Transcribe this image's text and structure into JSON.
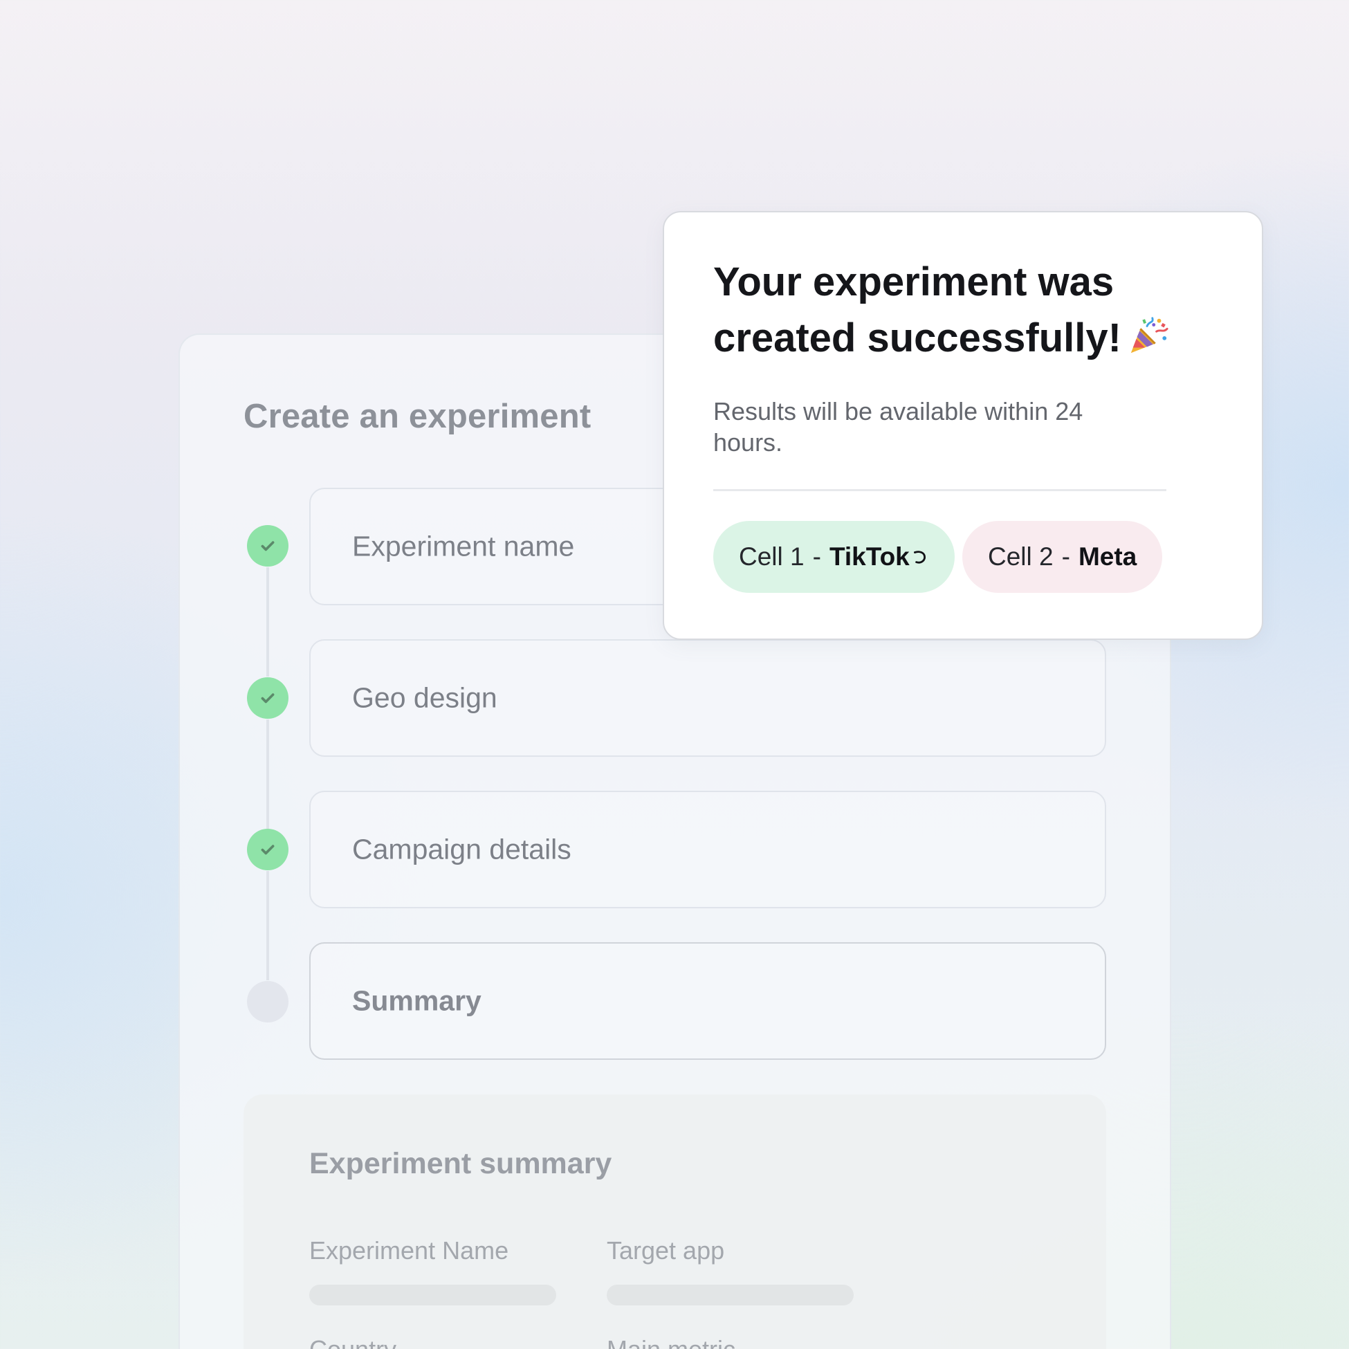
{
  "form": {
    "title": "Create an experiment",
    "steps": [
      {
        "label": "Experiment name",
        "status": "complete"
      },
      {
        "label": "Geo design",
        "status": "complete"
      },
      {
        "label": "Campaign details",
        "status": "complete"
      },
      {
        "label": "Summary",
        "status": "current"
      }
    ],
    "summary": {
      "title": "Experiment summary",
      "fields": [
        "Experiment Name",
        "Target app",
        "Country",
        "Main metric"
      ]
    }
  },
  "popover": {
    "title_line1": "Your experiment was",
    "title_line2": "created successfully!",
    "title_icon": "party-popper-icon",
    "subtitle": "Results will be available within 24 hours.",
    "cells": [
      {
        "prefix": "Cell 1",
        "separator": "-",
        "platform": "TikTok",
        "icon": "tiktok-icon",
        "color": "#dbf4e6"
      },
      {
        "prefix": "Cell 2",
        "separator": "-",
        "platform": "Meta",
        "color": "#f9ebef"
      }
    ]
  },
  "colors": {
    "step_complete": "#8fe3a8",
    "step_pending": "#e3e6ed",
    "check": "#5b8a6a"
  }
}
